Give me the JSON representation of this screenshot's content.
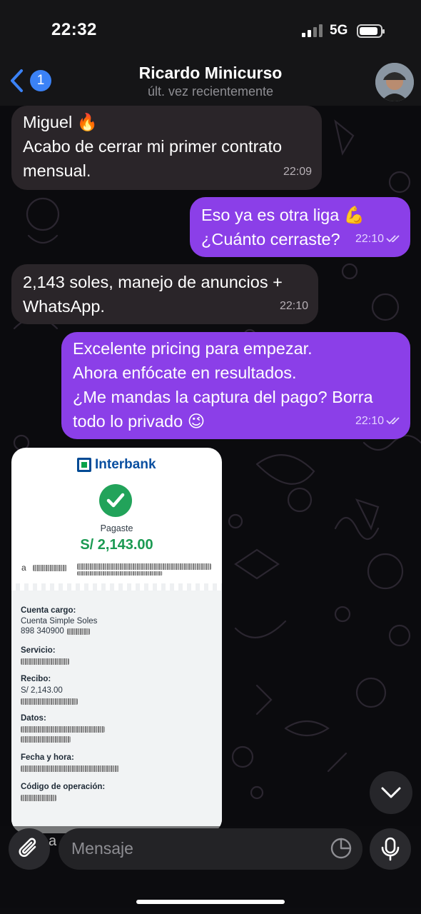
{
  "status_bar": {
    "time": "22:32",
    "network": "5G",
    "battery_level": 0.9
  },
  "header": {
    "back_badge": "1",
    "title": "Ricardo Minicurso",
    "subtitle": "últ. vez recientemente"
  },
  "messages": [
    {
      "direction": "in",
      "lines": [
        "Miguel 🔥",
        "Acabo de cerrar mi primer contrato",
        "mensual."
      ],
      "time": "22:09"
    },
    {
      "direction": "out",
      "lines": [
        "Eso ya es otra liga 💪",
        "¿Cuánto cerraste?"
      ],
      "time": "22:10"
    },
    {
      "direction": "in",
      "lines": [
        "2,143 soles, manejo de anuncios +",
        "WhatsApp."
      ],
      "time": "22:10"
    },
    {
      "direction": "out",
      "lines": [
        "Excelente pricing para empezar.",
        "Ahora enfócate en resultados.",
        "¿Me mandas la captura del pago? Borra",
        "todo lo privado 😉"
      ],
      "time": "22:10"
    }
  ],
  "receipt": {
    "bank": "Interbank",
    "status": "Pagaste",
    "amount": "S/ 2,143.00",
    "to_prefix": "a",
    "fields": [
      {
        "label": "Cuenta cargo:",
        "values": [
          "Cuenta Simple Soles",
          "898 340900"
        ]
      },
      {
        "label": "Servicio:",
        "values": []
      },
      {
        "label": "Recibo:",
        "values": [
          "S/ 2,143.00"
        ]
      },
      {
        "label": "Datos:",
        "values": []
      },
      {
        "label": "Fecha y hora:",
        "values": []
      },
      {
        "label": "Código de operación:",
        "values": []
      }
    ]
  },
  "composer": {
    "placeholder": "Mensaje"
  },
  "colors": {
    "incoming_bubble": "#2a2529",
    "outgoing_bubble": "#8b3fe8",
    "accent": "#3b82f6"
  }
}
